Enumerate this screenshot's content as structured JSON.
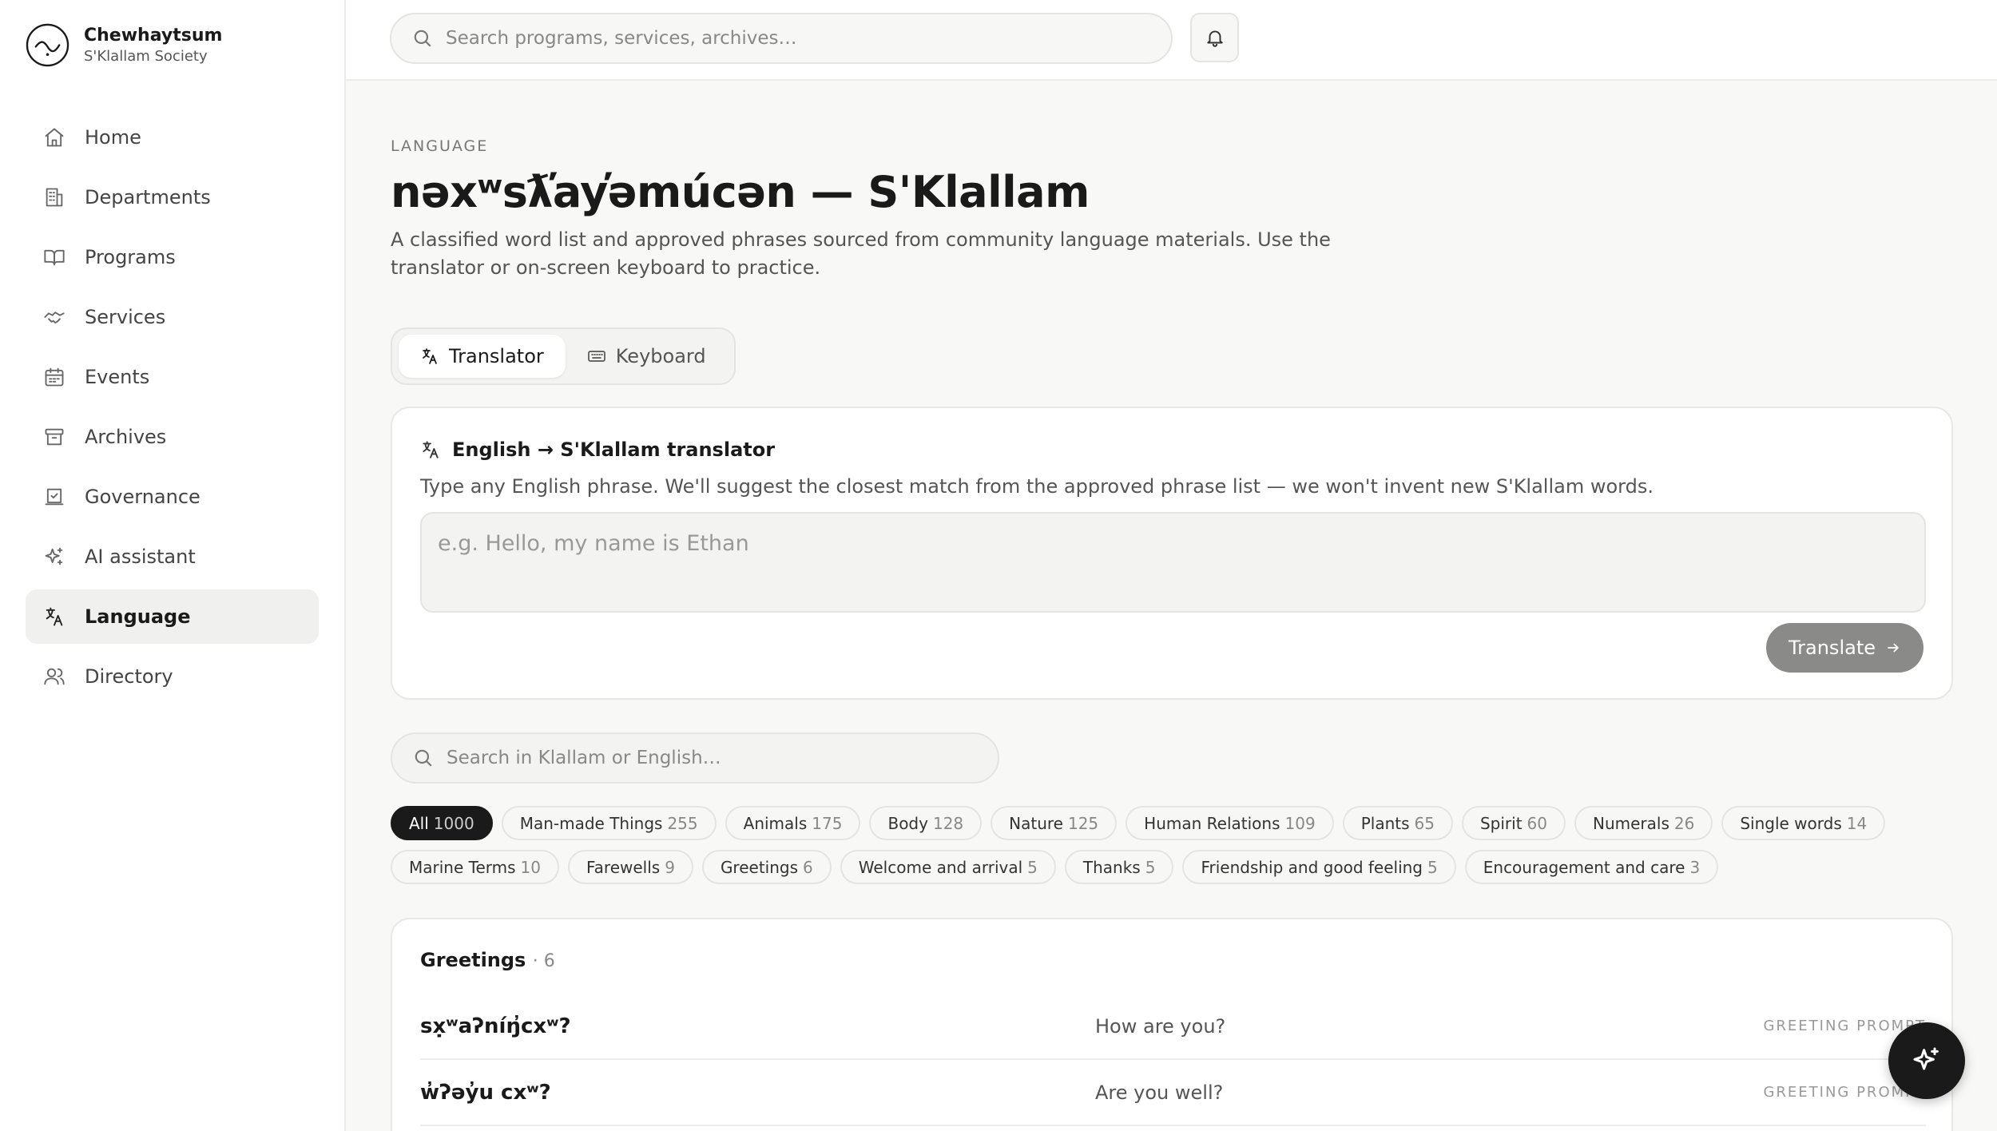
{
  "brand": {
    "name": "Chewhaytsum",
    "subtitle": "S'Klallam Society"
  },
  "sidebar": {
    "items": [
      {
        "label": "Home",
        "icon": "home-icon",
        "active": false
      },
      {
        "label": "Departments",
        "icon": "building-icon",
        "active": false
      },
      {
        "label": "Programs",
        "icon": "book-icon",
        "active": false
      },
      {
        "label": "Services",
        "icon": "handshake-icon",
        "active": false
      },
      {
        "label": "Events",
        "icon": "calendar-icon",
        "active": false
      },
      {
        "label": "Archives",
        "icon": "archive-icon",
        "active": false
      },
      {
        "label": "Governance",
        "icon": "ballot-icon",
        "active": false
      },
      {
        "label": "AI assistant",
        "icon": "sparkles-icon",
        "active": false
      },
      {
        "label": "Language",
        "icon": "translate-icon",
        "active": true
      },
      {
        "label": "Directory",
        "icon": "users-icon",
        "active": false
      }
    ]
  },
  "topbar": {
    "search_placeholder": "Search programs, services, archives…",
    "bell_icon": "bell-icon"
  },
  "page": {
    "eyebrow": "LANGUAGE",
    "title": "nəxʷsƛ̕ay̕əmúcən — S'Klallam",
    "description": "A classified word list and approved phrases sourced from community language materials. Use the translator or on-screen keyboard to practice."
  },
  "tabs": [
    {
      "label": "Translator",
      "icon": "translate-icon",
      "active": true
    },
    {
      "label": "Keyboard",
      "icon": "keyboard-icon",
      "active": false
    }
  ],
  "translator": {
    "heading": "English → S'Klallam translator",
    "subtitle": "Type any English phrase. We'll suggest the closest match from the approved phrase list — we won't invent new S'Klallam words.",
    "placeholder": "e.g. Hello, my name is Ethan",
    "button_label": "Translate"
  },
  "word_search": {
    "placeholder": "Search in Klallam or English…"
  },
  "categories": [
    {
      "label": "All",
      "count": "1000",
      "active": true
    },
    {
      "label": "Man-made Things",
      "count": "255",
      "active": false
    },
    {
      "label": "Animals",
      "count": "175",
      "active": false
    },
    {
      "label": "Body",
      "count": "128",
      "active": false
    },
    {
      "label": "Nature",
      "count": "125",
      "active": false
    },
    {
      "label": "Human Relations",
      "count": "109",
      "active": false
    },
    {
      "label": "Plants",
      "count": "65",
      "active": false
    },
    {
      "label": "Spirit",
      "count": "60",
      "active": false
    },
    {
      "label": "Numerals",
      "count": "26",
      "active": false
    },
    {
      "label": "Single words",
      "count": "14",
      "active": false
    },
    {
      "label": "Marine Terms",
      "count": "10",
      "active": false
    },
    {
      "label": "Farewells",
      "count": "9",
      "active": false
    },
    {
      "label": "Greetings",
      "count": "6",
      "active": false
    },
    {
      "label": "Welcome and arrival",
      "count": "5",
      "active": false
    },
    {
      "label": "Thanks",
      "count": "5",
      "active": false
    },
    {
      "label": "Friendship and good feeling",
      "count": "5",
      "active": false
    },
    {
      "label": "Encouragement and care",
      "count": "3",
      "active": false
    }
  ],
  "greetings": {
    "title": "Greetings",
    "count_label": "· 6",
    "rows": [
      {
        "klallam": "sx̣ʷaʔníŋ̓cxʷ?",
        "english": "How are you?",
        "tag": "GREETING PROMPT"
      },
      {
        "klallam": "w̓ʔəy̓u cxʷ?",
        "english": "Are you well?",
        "tag": "GREETING PROMPT"
      }
    ]
  },
  "fab": {
    "icon": "sparkles-icon"
  },
  "colors": {
    "accent": "#1a1a1a",
    "active_bg": "#f0f0ee",
    "button_gray": "#8a8a88"
  }
}
